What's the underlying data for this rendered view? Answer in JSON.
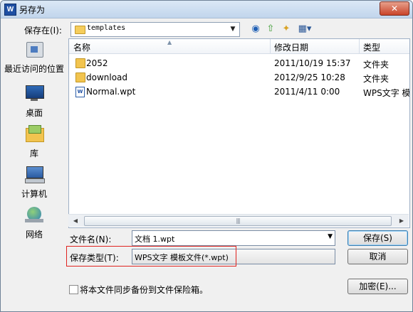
{
  "window": {
    "title": "另存为",
    "close_label": "✕"
  },
  "location": {
    "label": "保存在(I):",
    "value": "templates"
  },
  "toolbar": {
    "back_icon": "back-icon",
    "up_icon": "up-folder-icon",
    "new_folder_icon": "new-folder-icon",
    "views_icon": "views-menu-icon"
  },
  "places": [
    {
      "label": "最近访问的位置",
      "icon": "recent-places-icon"
    },
    {
      "label": "桌面",
      "icon": "desktop-icon"
    },
    {
      "label": "库",
      "icon": "libraries-icon"
    },
    {
      "label": "计算机",
      "icon": "computer-icon"
    },
    {
      "label": "网络",
      "icon": "network-icon"
    }
  ],
  "file_list": {
    "columns": [
      "名称",
      "修改日期",
      "类型"
    ],
    "rows": [
      {
        "name": "2052",
        "date": "2011/10/19 15:37",
        "type": "文件夹",
        "icon": "folder-icon"
      },
      {
        "name": "download",
        "date": "2012/9/25 10:28",
        "type": "文件夹",
        "icon": "folder-icon"
      },
      {
        "name": "Normal.wpt",
        "date": "2011/4/11 0:00",
        "type": "WPS文字 模",
        "icon": "wps-template-icon"
      }
    ]
  },
  "filename": {
    "label": "文件名(N):",
    "value": "文档 1.wpt"
  },
  "filetype": {
    "label": "保存类型(T):",
    "value": "WPS文字 模板文件(*.wpt)"
  },
  "buttons": {
    "save": "保存(S)",
    "cancel": "取消",
    "encrypt": "加密(E)..."
  },
  "sync_checkbox": {
    "label": "将本文件同步备份到文件保险箱。",
    "checked": false
  },
  "colors": {
    "highlight_box": "#e0231f",
    "title_gradient": "#c1d5ec"
  }
}
